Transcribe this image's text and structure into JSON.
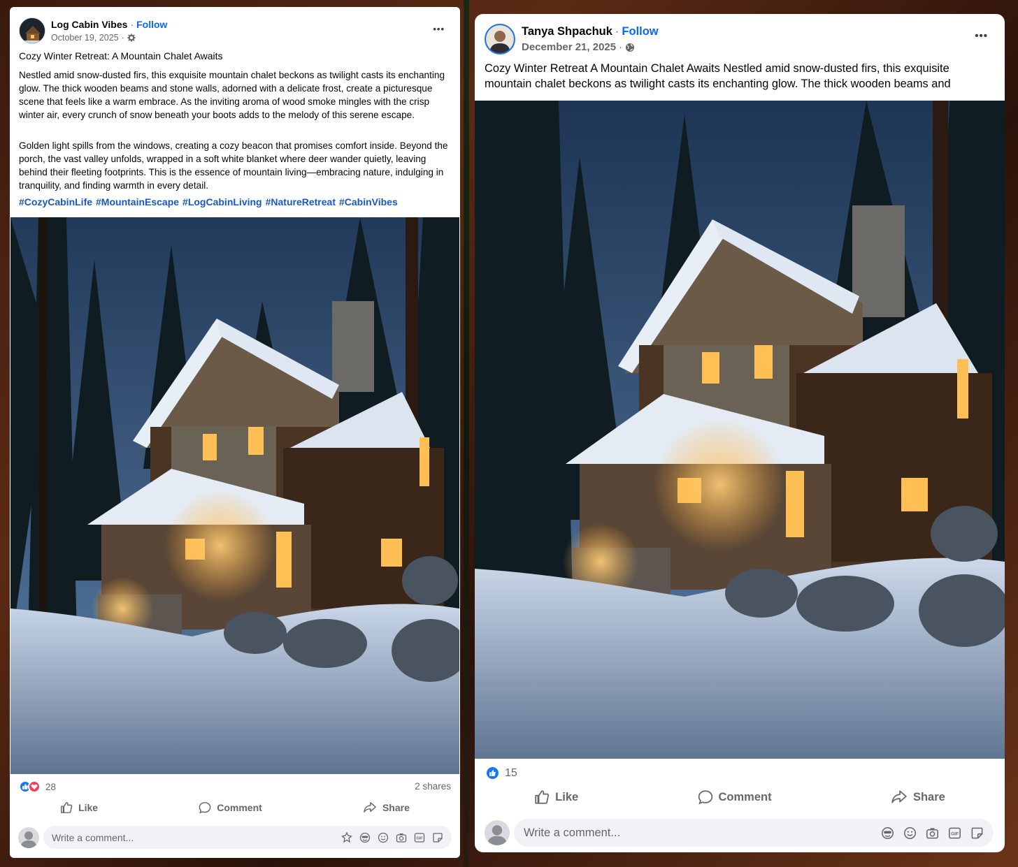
{
  "colors": {
    "follow_blue": "#0866ff",
    "hashtag_blue": "#1758c4",
    "like_blue": "#1877f2",
    "love_red": "#f33e58",
    "muted_text": "#65676b"
  },
  "left_post": {
    "author": "Log Cabin Vibes",
    "follow": "Follow",
    "separator": "·",
    "date": "October 19, 2025",
    "date_separator": "·",
    "audience_icon": "gear-icon",
    "more": "•••",
    "title": "Cozy Winter Retreat: A Mountain Chalet Awaits",
    "paragraph1": "Nestled amid snow-dusted firs, this exquisite mountain chalet beckons as twilight casts its enchanting glow. The thick wooden beams and stone walls, adorned with a delicate frost, create a picturesque scene that feels like a warm embrace. As the inviting aroma of wood smoke mingles with the crisp winter air, every crunch of snow beneath your boots adds to the melody of this serene escape.",
    "paragraph2": "Golden light spills from the windows, creating a cozy beacon that promises comfort inside. Beyond the porch, the vast valley unfolds, wrapped in a soft white blanket where deer wander quietly, leaving behind their fleeting footprints. This is the essence of mountain living—embracing nature, indulging in tranquility, and finding warmth in every detail.",
    "hashtags": [
      "#CozyCabinLife",
      "#MountainEscape",
      "#LogCabinLiving",
      "#NatureRetreat",
      "#CabinVibes"
    ],
    "reaction_count": "28",
    "reaction_icons": [
      "like-icon",
      "heart-icon"
    ],
    "shares": "2 shares",
    "actions": {
      "like": "Like",
      "comment": "Comment",
      "share": "Share"
    },
    "comment_placeholder": "Write a comment...",
    "comment_icons": [
      "avatar-sticker-icon",
      "emoji-mask-icon",
      "smiley-icon",
      "camera-icon",
      "gif-icon",
      "sticker-icon"
    ]
  },
  "right_post": {
    "author": "Tanya Shpachuk",
    "follow": "Follow",
    "separator": "·",
    "date": "December 21, 2025",
    "date_separator": "·",
    "audience_icon": "globe-icon",
    "more": "•••",
    "body": "Cozy Winter Retreat A Mountain Chalet Awaits Nestled amid snow-dusted firs, this exquisite mountain chalet beckons as twilight casts its enchanting glow. The thick wooden beams and",
    "reaction_count": "15",
    "reaction_icons": [
      "like-icon"
    ],
    "actions": {
      "like": "Like",
      "comment": "Comment",
      "share": "Share"
    },
    "comment_placeholder": "Write a comment...",
    "comment_icons": [
      "emoji-mask-icon",
      "smiley-icon",
      "camera-icon",
      "gif-icon",
      "sticker-icon"
    ]
  }
}
